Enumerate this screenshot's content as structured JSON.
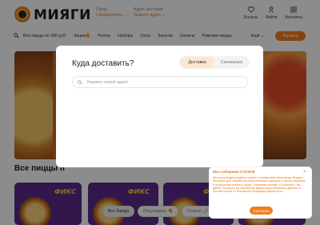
{
  "header": {
    "brand": "МИЯГИ",
    "city_label": "Город",
    "city_value": "Симферополь ⌄",
    "address_label": "Адрес доставки",
    "address_value": "Укажите адрес ⌄",
    "bonuses_label": "Бонусы",
    "login_label": "Войти",
    "contacts_label": "Контакты"
  },
  "nav": {
    "items": [
      "Все пиццы по 390 руб.",
      "Акции🔥",
      "Роллы",
      "Наборы",
      "Супы",
      "Закуски",
      "Салаты",
      "Римские пиццы"
    ],
    "more_label": "Ещё ⌄",
    "cart_label": "Корзина"
  },
  "main": {
    "section_title": "Все пиццы п",
    "card_tag": "ФИКС",
    "filters": [
      "Все блюда",
      "Популярное 🍕",
      "Острое 🌶"
    ]
  },
  "modal": {
    "title": "Куда доставить?",
    "tab_delivery": "Доставка",
    "tab_pickup": "Самовывоз",
    "address_placeholder": "Укажите новый адрес"
  },
  "cookie": {
    "title": "Мы собираем COOKIE",
    "text": "Мы используем файлы cookie и сервис веб-аналитики Яндекс Метрика для обработки персональных данных в целях анализа и улучшения работы сайта. Нажимая кнопку «Согласен», вы даете согласие на обработку ваших персональных данных в соответствии с Политикой конфиденциальности",
    "accept_label": "Согласен"
  },
  "colors": {
    "accent": "#f07d1f",
    "card_purple": "#5b2a8c",
    "tag_yellow": "#ffcc2e"
  }
}
